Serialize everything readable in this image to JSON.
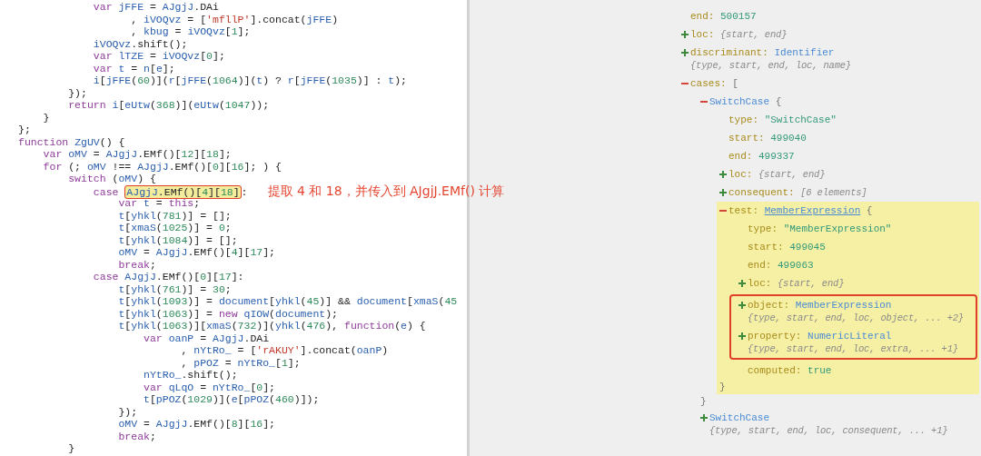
{
  "code_editor": {
    "lines": [
      {
        "tokens": [
          {
            "t": "            var ",
            "kind": "kw"
          },
          {
            "t": "jFFE",
            "kind": "var"
          },
          {
            "t": " = ",
            "kind": "p"
          },
          {
            "t": "AJgjJ",
            "kind": "var"
          },
          {
            "t": ".DAi",
            "kind": "p"
          }
        ]
      },
      {
        "tokens": [
          {
            "t": "                  , ",
            "kind": "p"
          },
          {
            "t": "iVOQvz",
            "kind": "var"
          },
          {
            "t": " = [",
            "kind": "p"
          },
          {
            "t": "'mfllP'",
            "kind": "str"
          },
          {
            "t": "].concat(",
            "kind": "p"
          },
          {
            "t": "jFFE",
            "kind": "var"
          },
          {
            "t": ")",
            "kind": "p"
          }
        ]
      },
      {
        "tokens": [
          {
            "t": "                  , ",
            "kind": "p"
          },
          {
            "t": "kbug",
            "kind": "var"
          },
          {
            "t": " = ",
            "kind": "p"
          },
          {
            "t": "iVOQvz",
            "kind": "var"
          },
          {
            "t": "[",
            "kind": "p"
          },
          {
            "t": "1",
            "kind": "num"
          },
          {
            "t": "];",
            "kind": "p"
          }
        ]
      },
      {
        "tokens": [
          {
            "t": "            iVOQvz",
            "kind": "var"
          },
          {
            "t": ".shift();",
            "kind": "p"
          }
        ]
      },
      {
        "tokens": [
          {
            "t": "            var ",
            "kind": "kw"
          },
          {
            "t": "lTZE",
            "kind": "var"
          },
          {
            "t": " = ",
            "kind": "p"
          },
          {
            "t": "iVOQvz",
            "kind": "var"
          },
          {
            "t": "[",
            "kind": "p"
          },
          {
            "t": "0",
            "kind": "num"
          },
          {
            "t": "];",
            "kind": "p"
          }
        ]
      },
      {
        "tokens": [
          {
            "t": "            var ",
            "kind": "kw"
          },
          {
            "t": "t",
            "kind": "var"
          },
          {
            "t": " = ",
            "kind": "p"
          },
          {
            "t": "n",
            "kind": "var"
          },
          {
            "t": "[",
            "kind": "p"
          },
          {
            "t": "e",
            "kind": "var"
          },
          {
            "t": "];",
            "kind": "p"
          }
        ]
      },
      {
        "tokens": [
          {
            "t": "            i",
            "kind": "var"
          },
          {
            "t": "[",
            "kind": "p"
          },
          {
            "t": "jFFE",
            "kind": "var"
          },
          {
            "t": "(",
            "kind": "p"
          },
          {
            "t": "60",
            "kind": "num"
          },
          {
            "t": ")](",
            "kind": "p"
          },
          {
            "t": "r",
            "kind": "var"
          },
          {
            "t": "[",
            "kind": "p"
          },
          {
            "t": "jFFE",
            "kind": "var"
          },
          {
            "t": "(",
            "kind": "p"
          },
          {
            "t": "1064",
            "kind": "num"
          },
          {
            "t": ")](",
            "kind": "p"
          },
          {
            "t": "t",
            "kind": "var"
          },
          {
            "t": ") ? ",
            "kind": "p"
          },
          {
            "t": "r",
            "kind": "var"
          },
          {
            "t": "[",
            "kind": "p"
          },
          {
            "t": "jFFE",
            "kind": "var"
          },
          {
            "t": "(",
            "kind": "p"
          },
          {
            "t": "1035",
            "kind": "num"
          },
          {
            "t": ")] : ",
            "kind": "p"
          },
          {
            "t": "t",
            "kind": "var"
          },
          {
            "t": ");",
            "kind": "p"
          }
        ]
      },
      {
        "tokens": [
          {
            "t": "        });",
            "kind": "p"
          }
        ]
      },
      {
        "tokens": [
          {
            "t": "        return ",
            "kind": "kw"
          },
          {
            "t": "i",
            "kind": "var"
          },
          {
            "t": "[",
            "kind": "p"
          },
          {
            "t": "eUtw",
            "kind": "var"
          },
          {
            "t": "(",
            "kind": "p"
          },
          {
            "t": "368",
            "kind": "num"
          },
          {
            "t": ")](",
            "kind": "p"
          },
          {
            "t": "eUtw",
            "kind": "var"
          },
          {
            "t": "(",
            "kind": "p"
          },
          {
            "t": "1047",
            "kind": "num"
          },
          {
            "t": "));",
            "kind": "p"
          }
        ]
      },
      {
        "tokens": [
          {
            "t": "    }",
            "kind": "p"
          }
        ]
      },
      {
        "tokens": [
          {
            "t": "};",
            "kind": "p"
          }
        ]
      },
      {
        "tokens": [
          {
            "t": "function ",
            "kind": "kw"
          },
          {
            "t": "ZgUV",
            "kind": "var"
          },
          {
            "t": "() {",
            "kind": "p"
          }
        ]
      },
      {
        "tokens": [
          {
            "t": "    var ",
            "kind": "kw"
          },
          {
            "t": "oMV",
            "kind": "var"
          },
          {
            "t": " = ",
            "kind": "p"
          },
          {
            "t": "AJgjJ",
            "kind": "var"
          },
          {
            "t": ".EMf()[",
            "kind": "p"
          },
          {
            "t": "12",
            "kind": "num"
          },
          {
            "t": "][",
            "kind": "p"
          },
          {
            "t": "18",
            "kind": "num"
          },
          {
            "t": "];",
            "kind": "p"
          }
        ]
      },
      {
        "tokens": [
          {
            "t": "    for ",
            "kind": "kw"
          },
          {
            "t": "(; ",
            "kind": "p"
          },
          {
            "t": "oMV",
            "kind": "var"
          },
          {
            "t": " !== ",
            "kind": "p"
          },
          {
            "t": "AJgjJ",
            "kind": "var"
          },
          {
            "t": ".EMf()[",
            "kind": "p"
          },
          {
            "t": "0",
            "kind": "num"
          },
          {
            "t": "][",
            "kind": "p"
          },
          {
            "t": "16",
            "kind": "num"
          },
          {
            "t": "]; ) {",
            "kind": "p"
          }
        ]
      },
      {
        "tokens": [
          {
            "t": "        switch ",
            "kind": "kw"
          },
          {
            "t": "(",
            "kind": "p"
          },
          {
            "t": "oMV",
            "kind": "var"
          },
          {
            "t": ") {",
            "kind": "p"
          }
        ]
      },
      {
        "tokens": [
          {
            "t": "            case ",
            "kind": "kw"
          },
          {
            "highlighted": true,
            "tokens": [
              {
                "t": "AJgjJ",
                "kind": "var"
              },
              {
                "t": ".EMf()[",
                "kind": "p"
              },
              {
                "t": "4",
                "kind": "num"
              },
              {
                "t": "][",
                "kind": "p"
              },
              {
                "t": "18",
                "kind": "num"
              },
              {
                "t": "]",
                "kind": "p"
              }
            ]
          },
          {
            "t": ":",
            "kind": "p"
          }
        ],
        "note": "提取 4 和 18，并传入到 AJgjJ.EMf() 计算"
      },
      {
        "tokens": [
          {
            "t": "                var ",
            "kind": "kw"
          },
          {
            "t": "t",
            "kind": "var"
          },
          {
            "t": " = ",
            "kind": "p"
          },
          {
            "t": "this",
            "kind": "kw"
          },
          {
            "t": ";",
            "kind": "p"
          }
        ]
      },
      {
        "tokens": [
          {
            "t": "                t",
            "kind": "var"
          },
          {
            "t": "[",
            "kind": "p"
          },
          {
            "t": "yhkl",
            "kind": "var"
          },
          {
            "t": "(",
            "kind": "p"
          },
          {
            "t": "781",
            "kind": "num"
          },
          {
            "t": ")] = [];",
            "kind": "p"
          }
        ]
      },
      {
        "tokens": [
          {
            "t": "                t",
            "kind": "var"
          },
          {
            "t": "[",
            "kind": "p"
          },
          {
            "t": "xmaS",
            "kind": "var"
          },
          {
            "t": "(",
            "kind": "p"
          },
          {
            "t": "1025",
            "kind": "num"
          },
          {
            "t": ")] = ",
            "kind": "p"
          },
          {
            "t": "0",
            "kind": "num"
          },
          {
            "t": ";",
            "kind": "p"
          }
        ]
      },
      {
        "tokens": [
          {
            "t": "                t",
            "kind": "var"
          },
          {
            "t": "[",
            "kind": "p"
          },
          {
            "t": "yhkl",
            "kind": "var"
          },
          {
            "t": "(",
            "kind": "p"
          },
          {
            "t": "1084",
            "kind": "num"
          },
          {
            "t": ")] = [];",
            "kind": "p"
          }
        ]
      },
      {
        "tokens": [
          {
            "t": "                oMV",
            "kind": "var"
          },
          {
            "t": " = ",
            "kind": "p"
          },
          {
            "t": "AJgjJ",
            "kind": "var"
          },
          {
            "t": ".EMf()[",
            "kind": "p"
          },
          {
            "t": "4",
            "kind": "num"
          },
          {
            "t": "][",
            "kind": "p"
          },
          {
            "t": "17",
            "kind": "num"
          },
          {
            "t": "];",
            "kind": "p"
          }
        ]
      },
      {
        "tokens": [
          {
            "t": "                break",
            "kind": "kw"
          },
          {
            "t": ";",
            "kind": "p"
          }
        ]
      },
      {
        "tokens": [
          {
            "t": "            case ",
            "kind": "kw"
          },
          {
            "t": "AJgjJ",
            "kind": "var"
          },
          {
            "t": ".EMf()[",
            "kind": "p"
          },
          {
            "t": "0",
            "kind": "num"
          },
          {
            "t": "][",
            "kind": "p"
          },
          {
            "t": "17",
            "kind": "num"
          },
          {
            "t": "]:",
            "kind": "p"
          }
        ]
      },
      {
        "tokens": [
          {
            "t": "                t",
            "kind": "var"
          },
          {
            "t": "[",
            "kind": "p"
          },
          {
            "t": "yhkl",
            "kind": "var"
          },
          {
            "t": "(",
            "kind": "p"
          },
          {
            "t": "761",
            "kind": "num"
          },
          {
            "t": ")] = ",
            "kind": "p"
          },
          {
            "t": "30",
            "kind": "num"
          },
          {
            "t": ";",
            "kind": "p"
          }
        ]
      },
      {
        "tokens": [
          {
            "t": "                t",
            "kind": "var"
          },
          {
            "t": "[",
            "kind": "p"
          },
          {
            "t": "yhkl",
            "kind": "var"
          },
          {
            "t": "(",
            "kind": "p"
          },
          {
            "t": "1093",
            "kind": "num"
          },
          {
            "t": ")] = ",
            "kind": "p"
          },
          {
            "t": "document",
            "kind": "var"
          },
          {
            "t": "[",
            "kind": "p"
          },
          {
            "t": "yhkl",
            "kind": "var"
          },
          {
            "t": "(",
            "kind": "p"
          },
          {
            "t": "45",
            "kind": "num"
          },
          {
            "t": ")] && ",
            "kind": "p"
          },
          {
            "t": "document",
            "kind": "var"
          },
          {
            "t": "[",
            "kind": "p"
          },
          {
            "t": "xmaS",
            "kind": "var"
          },
          {
            "t": "(",
            "kind": "p"
          },
          {
            "t": "45",
            "kind": "num"
          }
        ]
      },
      {
        "tokens": [
          {
            "t": "                t",
            "kind": "var"
          },
          {
            "t": "[",
            "kind": "p"
          },
          {
            "t": "yhkl",
            "kind": "var"
          },
          {
            "t": "(",
            "kind": "p"
          },
          {
            "t": "1063",
            "kind": "num"
          },
          {
            "t": ")] = ",
            "kind": "p"
          },
          {
            "t": "new ",
            "kind": "kw"
          },
          {
            "t": "qIOW",
            "kind": "var"
          },
          {
            "t": "(",
            "kind": "p"
          },
          {
            "t": "document",
            "kind": "var"
          },
          {
            "t": ");",
            "kind": "p"
          }
        ]
      },
      {
        "tokens": [
          {
            "t": "                t",
            "kind": "var"
          },
          {
            "t": "[",
            "kind": "p"
          },
          {
            "t": "yhkl",
            "kind": "var"
          },
          {
            "t": "(",
            "kind": "p"
          },
          {
            "t": "1063",
            "kind": "num"
          },
          {
            "t": ")][",
            "kind": "p"
          },
          {
            "t": "xmaS",
            "kind": "var"
          },
          {
            "t": "(",
            "kind": "p"
          },
          {
            "t": "732",
            "kind": "num"
          },
          {
            "t": ")](",
            "kind": "p"
          },
          {
            "t": "yhkl",
            "kind": "var"
          },
          {
            "t": "(",
            "kind": "p"
          },
          {
            "t": "476",
            "kind": "num"
          },
          {
            "t": "), ",
            "kind": "p"
          },
          {
            "t": "function",
            "kind": "kw"
          },
          {
            "t": "(",
            "kind": "p"
          },
          {
            "t": "e",
            "kind": "var"
          },
          {
            "t": ") {",
            "kind": "p"
          }
        ]
      },
      {
        "tokens": [
          {
            "t": "                    var ",
            "kind": "kw"
          },
          {
            "t": "oanP",
            "kind": "var"
          },
          {
            "t": " = ",
            "kind": "p"
          },
          {
            "t": "AJgjJ",
            "kind": "var"
          },
          {
            "t": ".DAi",
            "kind": "p"
          }
        ]
      },
      {
        "tokens": [
          {
            "t": "                          , ",
            "kind": "p"
          },
          {
            "t": "nYtRo_",
            "kind": "var"
          },
          {
            "t": " = [",
            "kind": "p"
          },
          {
            "t": "'rAKUY'",
            "kind": "str"
          },
          {
            "t": "].concat(",
            "kind": "p"
          },
          {
            "t": "oanP",
            "kind": "var"
          },
          {
            "t": ")",
            "kind": "p"
          }
        ]
      },
      {
        "tokens": [
          {
            "t": "                          , ",
            "kind": "p"
          },
          {
            "t": "pPOZ",
            "kind": "var"
          },
          {
            "t": " = ",
            "kind": "p"
          },
          {
            "t": "nYtRo_",
            "kind": "var"
          },
          {
            "t": "[",
            "kind": "p"
          },
          {
            "t": "1",
            "kind": "num"
          },
          {
            "t": "];",
            "kind": "p"
          }
        ]
      },
      {
        "tokens": [
          {
            "t": "                    nYtRo_",
            "kind": "var"
          },
          {
            "t": ".shift();",
            "kind": "p"
          }
        ]
      },
      {
        "tokens": [
          {
            "t": "                    var ",
            "kind": "kw"
          },
          {
            "t": "qLqO",
            "kind": "var"
          },
          {
            "t": " = ",
            "kind": "p"
          },
          {
            "t": "nYtRo_",
            "kind": "var"
          },
          {
            "t": "[",
            "kind": "p"
          },
          {
            "t": "0",
            "kind": "num"
          },
          {
            "t": "];",
            "kind": "p"
          }
        ]
      },
      {
        "tokens": [
          {
            "t": "                    t",
            "kind": "var"
          },
          {
            "t": "[",
            "kind": "p"
          },
          {
            "t": "pPOZ",
            "kind": "var"
          },
          {
            "t": "(",
            "kind": "p"
          },
          {
            "t": "1029",
            "kind": "num"
          },
          {
            "t": ")](",
            "kind": "p"
          },
          {
            "t": "e",
            "kind": "var"
          },
          {
            "t": "[",
            "kind": "p"
          },
          {
            "t": "pPOZ",
            "kind": "var"
          },
          {
            "t": "(",
            "kind": "p"
          },
          {
            "t": "460",
            "kind": "num"
          },
          {
            "t": ")]);",
            "kind": "p"
          }
        ]
      },
      {
        "tokens": [
          {
            "t": "                });",
            "kind": "p"
          }
        ]
      },
      {
        "tokens": [
          {
            "t": "                oMV",
            "kind": "var"
          },
          {
            "t": " = ",
            "kind": "p"
          },
          {
            "t": "AJgjJ",
            "kind": "var"
          },
          {
            "t": ".EMf()[",
            "kind": "p"
          },
          {
            "t": "8",
            "kind": "num"
          },
          {
            "t": "][",
            "kind": "p"
          },
          {
            "t": "16",
            "kind": "num"
          },
          {
            "t": "];",
            "kind": "p"
          }
        ]
      },
      {
        "tokens": [
          {
            "t": "                break",
            "kind": "kw"
          },
          {
            "t": ";",
            "kind": "p"
          }
        ]
      },
      {
        "tokens": [
          {
            "t": "        }",
            "kind": "p"
          }
        ]
      }
    ]
  },
  "ast_tree": {
    "nodes": [
      {
        "key": "end:",
        "value": "500157"
      },
      {
        "key": "loc:",
        "expanded": false,
        "summary": "{start, end}"
      },
      {
        "key": "discriminant:",
        "expanded": false,
        "type_name": "Identifier",
        "hovered": false,
        "summary": "{type, start, end, loc, name}"
      },
      {
        "key": "cases:",
        "expanded": true,
        "open": "[",
        "children": [
          {
            "type_name": "SwitchCase",
            "hovered": false,
            "expanded": true,
            "open": "{",
            "close": "}",
            "children": [
              {
                "key": "type:",
                "value": "\"SwitchCase\""
              },
              {
                "key": "start:",
                "value": "499040"
              },
              {
                "key": "end:",
                "value": "499337"
              },
              {
                "key": "loc:",
                "expanded": false,
                "summary": "{start, end}"
              },
              {
                "key": "consequent:",
                "expanded": false,
                "summary": "[6 elements]"
              },
              {
                "key": "test:",
                "type_name": "MemberExpression",
                "hovered": true,
                "highlighted": true,
                "expanded": true,
                "open": "{",
                "close": "}",
                "children": [
                  {
                    "key": "type:",
                    "value": "\"MemberExpression\""
                  },
                  {
                    "key": "start:",
                    "value": "499045"
                  },
                  {
                    "key": "end:",
                    "value": "499063"
                  },
                  {
                    "key": "loc:",
                    "expanded": false,
                    "summary": "{start, end}"
                  },
                  {
                    "key": "object:",
                    "expanded": false,
                    "boxed": true,
                    "type_name": "MemberExpression",
                    "hovered": false,
                    "summary": "{type, start, end, loc, object, ... +2}"
                  },
                  {
                    "key": "property:",
                    "expanded": false,
                    "boxed": true,
                    "type_name": "NumericLiteral",
                    "hovered": false,
                    "summary": "{type, start, end, loc, extra, ... +1}"
                  },
                  {
                    "key": "computed:",
                    "value": "true"
                  }
                ]
              }
            ]
          },
          {
            "type_name": "SwitchCase",
            "hovered": false,
            "expanded": false,
            "summary": "{type, start, end, loc, consequent, ... +1}"
          }
        ]
      }
    ]
  }
}
